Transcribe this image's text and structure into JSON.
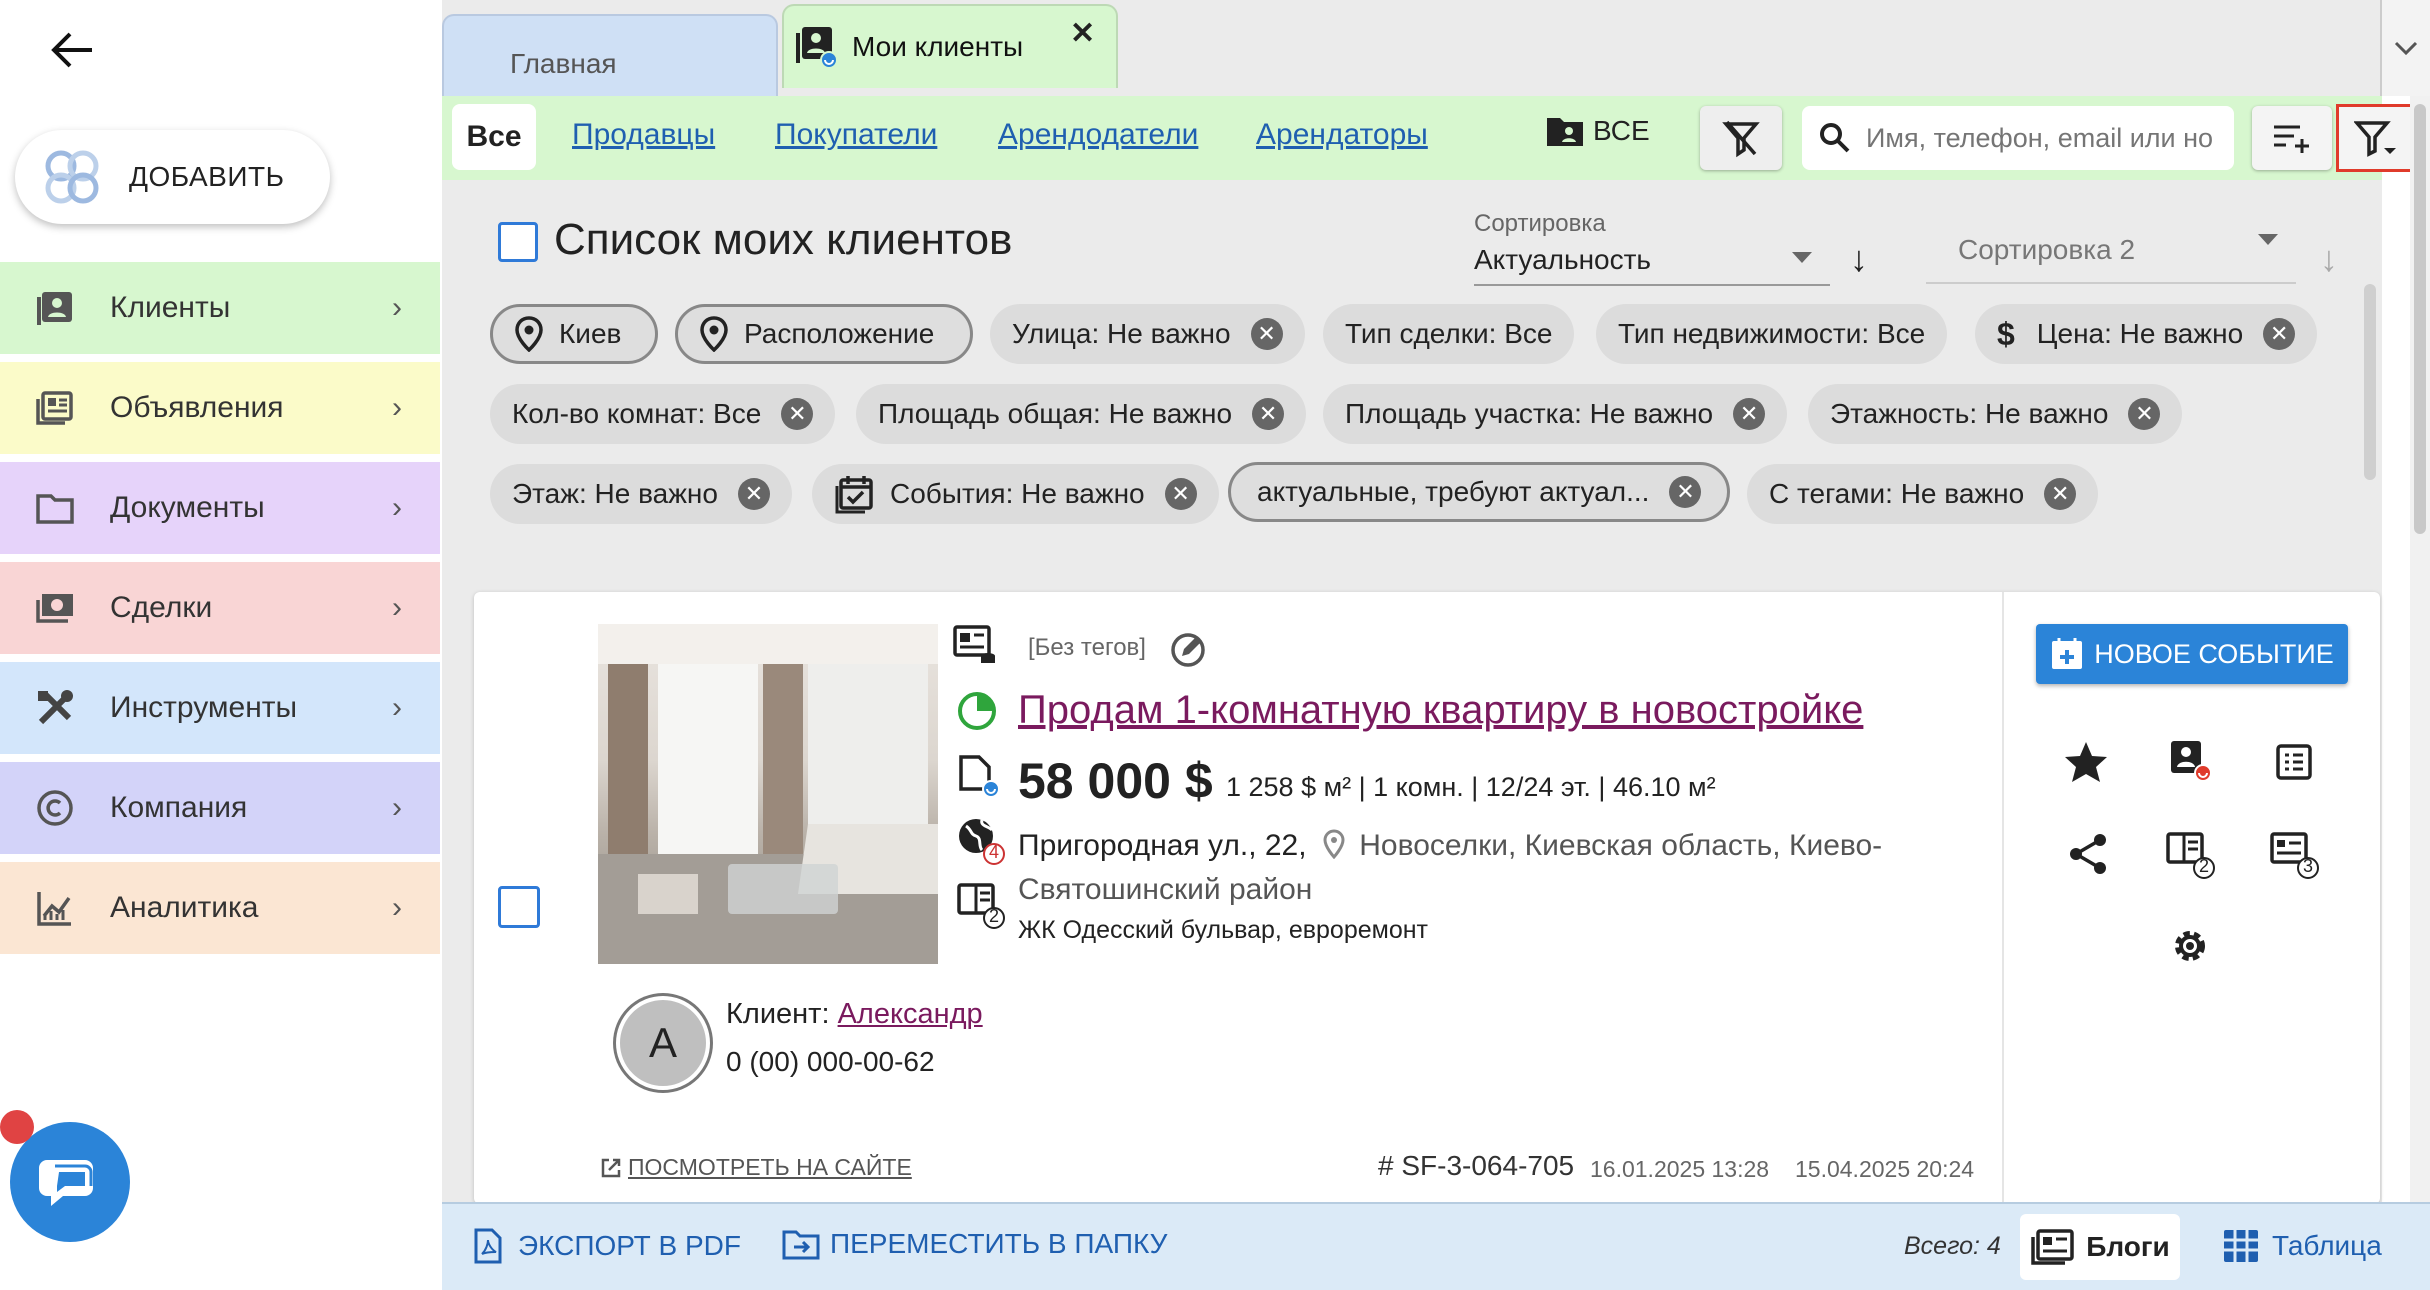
{
  "sidebar": {
    "add_label": "ДОБАВИТЬ",
    "items": [
      {
        "label": "Клиенты",
        "color": "#d7f7cf"
      },
      {
        "label": "Объявления",
        "color": "#fbfbc9"
      },
      {
        "label": "Документы",
        "color": "#e6d3fa"
      },
      {
        "label": "Сделки",
        "color": "#f9d5d5"
      },
      {
        "label": "Инструменты",
        "color": "#d3e6fb"
      },
      {
        "label": "Компания",
        "color": "#d3d3f9"
      },
      {
        "label": "Аналитика",
        "color": "#fbe6d3"
      }
    ]
  },
  "tabs": {
    "home": "Главная",
    "clients": "Мои клиенты"
  },
  "segments": {
    "all": "Все",
    "sellers": "Продавцы",
    "buyers": "Покупатели",
    "landlords": "Арендодатели",
    "tenants": "Арендаторы",
    "folder_all": "ВСЕ"
  },
  "search": {
    "placeholder": "Имя, телефон, email или но"
  },
  "list": {
    "title": "Список моих клиентов",
    "sort1_label": "Сортировка",
    "sort1_value": "Актуальность",
    "sort2_placeholder": "Сортировка 2"
  },
  "chips": [
    "Киев",
    "Расположение",
    "Улица: Не важно",
    "Тип сделки: Все",
    "Тип недвижимости: Все",
    "Цена: Не важно",
    "Кол-во комнат: Все",
    "Площадь общая: Не важно",
    "Площадь участка: Не важно",
    "Этажность: Не важно",
    "Этаж: Не важно",
    "События: Не важно",
    "актуальные, требуют актуал...",
    "С тегами: Не важно"
  ],
  "card": {
    "tags": "[Без тегов]",
    "title": "Продам 1-комнатную квартиру в новостройке",
    "price": "58 000 $",
    "specs": "1 258 $ м² | 1 комн. | 12/24 эт. | 46.10 м²",
    "street": "Пригородная ул., 22,",
    "location": "Новоселки, Киевская область, Киево-Святошинский район",
    "complex": "ЖК Одесский бульвар, евроремонт",
    "badge_globe": "4",
    "badge_doc": "2",
    "client_label": "Клиент:",
    "client_name": "Александр",
    "client_initial": "A",
    "client_phone": "0 (00) 000-00-62",
    "view_site": "ПОСМОТРЕТЬ НА САЙТЕ",
    "id": "# SF-3-064-705",
    "created": "16.01.2025 13:28",
    "updated": "15.04.2025 20:24",
    "new_event": "НОВОЕ СОБЫТИЕ",
    "badge_listing": "2",
    "badge_grid": "3"
  },
  "bottom": {
    "export_pdf": "ЭКСПОРТ В PDF",
    "move_folder": "ПЕРЕМЕСТИТЬ В ПАПКУ",
    "total": "Всего: 4",
    "blogs": "Блоги",
    "table": "Таблица"
  },
  "colors": {
    "accent": "#2b84d8",
    "link": "#1f5fb0",
    "title_link": "#7a1a5e",
    "segment_bg": "#d7f7cf",
    "filter_highlight": "#e03b2b"
  }
}
